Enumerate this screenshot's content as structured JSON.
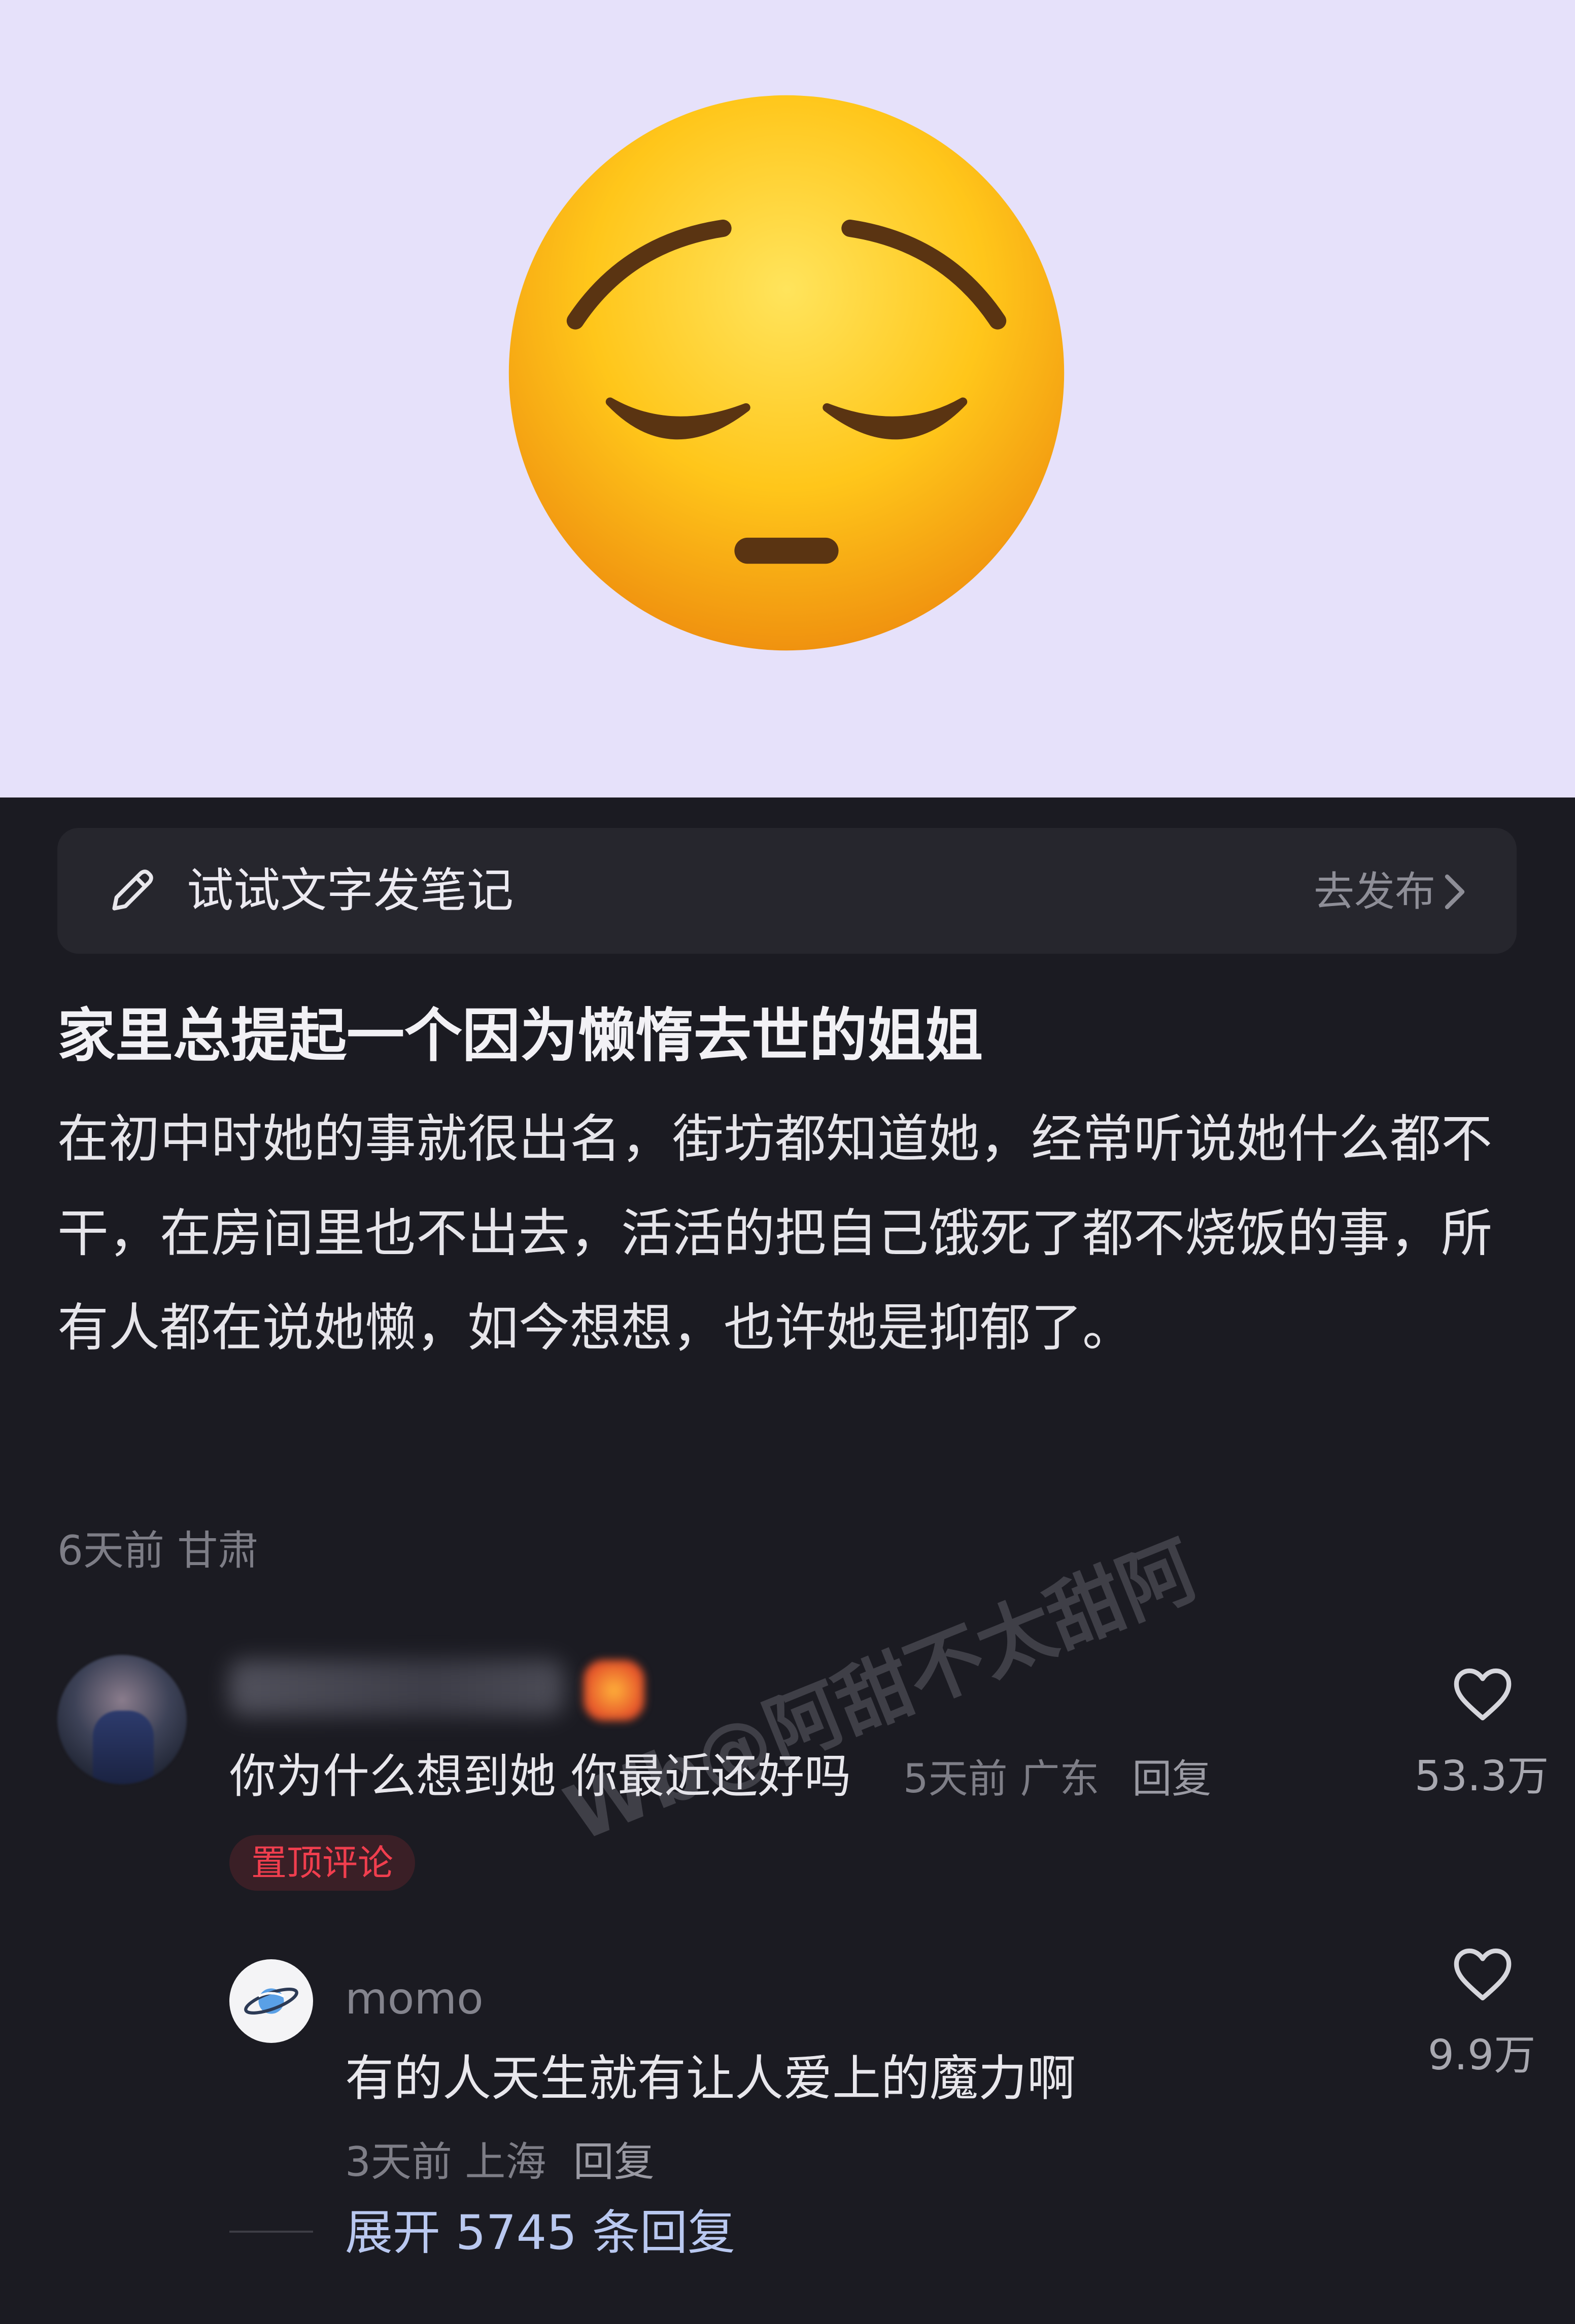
{
  "hero": {
    "emoji_icon": "pensive-face-emoji",
    "background": "#e6e1fa"
  },
  "publish_bar": {
    "icon": "pencil-icon",
    "prompt": "试试文字发笔记",
    "action_label": "去发布",
    "action_icon": "chevron-right-icon"
  },
  "post": {
    "title": "家里总提起一个因为懒惰去世的姐姐",
    "body": "在初中时她的事就很出名，街坊都知道她，经常听说她什么都不干，在房间里也不出去，活活的把自己饿死了都不烧饭的事，所有人都在说她懒，如今想想，也许她是抑郁了。",
    "time": "6天前",
    "location": "甘肃"
  },
  "comment": {
    "text": "你为什么想到她 你最近还好吗",
    "time": "5天前",
    "location": "广东",
    "reply_label": "回复",
    "like_count": "53.3万",
    "pinned_label": "置顶评论"
  },
  "reply": {
    "username": "momo",
    "avatar_icon": "planet-icon",
    "text": "有的人天生就有让人爱上的魔力啊",
    "time": "3天前",
    "location": "上海",
    "reply_label": "回复",
    "like_count": "9.9万"
  },
  "expand_label": "展开 5745 条回复",
  "watermark": "Wb@阿甜不太甜阿",
  "colors": {
    "dark_bg": "#1b1b22",
    "pinned_red": "#f03e4e",
    "link_blue": "#b9c8f0"
  }
}
